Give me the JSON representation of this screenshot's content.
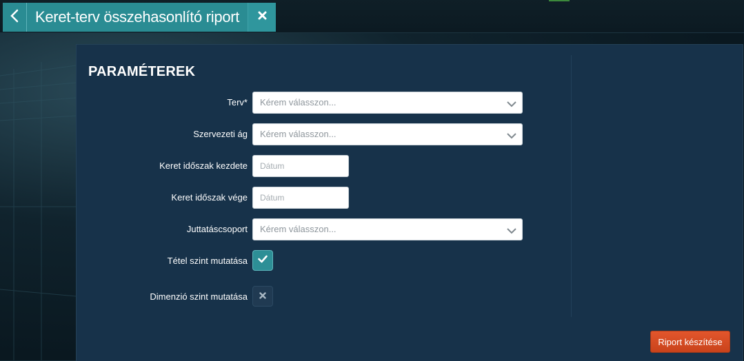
{
  "window": {
    "tab_title": "Keret-terv összehasonlító riport",
    "back_icon": "chevron-left-icon",
    "close_icon": "close-icon"
  },
  "form": {
    "heading": "PARAMÉTEREK",
    "fields": [
      {
        "label": "Terv*",
        "type": "select",
        "placeholder": "Kérem válasszon..."
      },
      {
        "label": "Szervezeti ág",
        "type": "select",
        "placeholder": "Kérem válasszon..."
      },
      {
        "label": "Keret időszak kezdete",
        "type": "date",
        "placeholder": "Dátum"
      },
      {
        "label": "Keret időszak vége",
        "type": "date",
        "placeholder": "Dátum"
      },
      {
        "label": "Juttatáscsoport",
        "type": "select",
        "placeholder": "Kérem válasszon..."
      },
      {
        "label": "Tétel szint mutatása",
        "type": "toggle",
        "checked": true
      },
      {
        "label": "Dimenzió szint mutatása",
        "type": "toggle",
        "checked": false
      }
    ]
  },
  "actions": {
    "submit_label": "Riport készítése"
  },
  "colors": {
    "tab": "#2a8c93",
    "panel": "#17324a",
    "button": "#d84b22"
  }
}
